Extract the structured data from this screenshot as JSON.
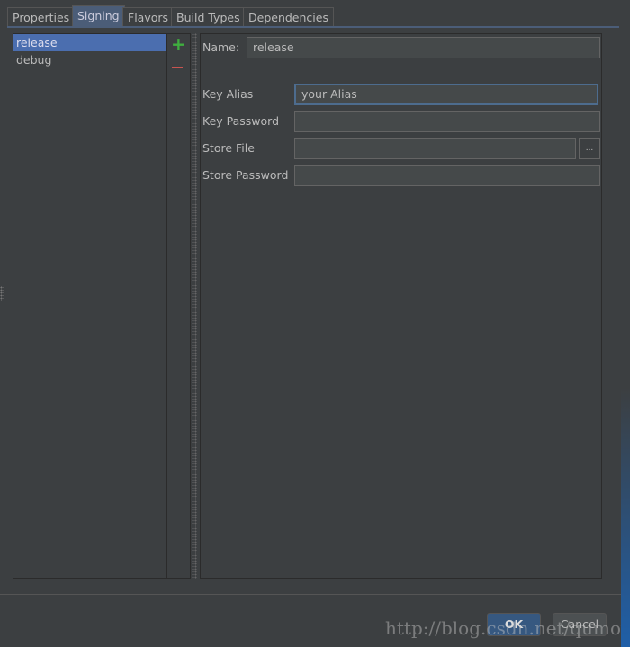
{
  "tabs": [
    {
      "label": "Properties"
    },
    {
      "label": "Signing"
    },
    {
      "label": "Flavors"
    },
    {
      "label": "Build Types"
    },
    {
      "label": "Dependencies"
    }
  ],
  "configs": [
    {
      "label": "release"
    },
    {
      "label": "debug"
    }
  ],
  "icons": {
    "add": "plus-icon",
    "remove": "minus-icon"
  },
  "form": {
    "name_label": "Name:",
    "name_value": "release",
    "key_alias_label": "Key Alias",
    "key_alias_value": "your Alias",
    "key_password_label": "Key Password",
    "key_password_value": "",
    "store_file_label": "Store File",
    "store_file_value": "",
    "browse_label": "...",
    "store_password_label": "Store Password",
    "store_password_value": ""
  },
  "buttons": {
    "ok": "OK",
    "cancel": "Cancel"
  },
  "watermark": "http://blog.csdn.net/qumoy",
  "colors": {
    "selection": "#4b6eaf",
    "add": "#3fae3f",
    "remove": "#c75450"
  }
}
